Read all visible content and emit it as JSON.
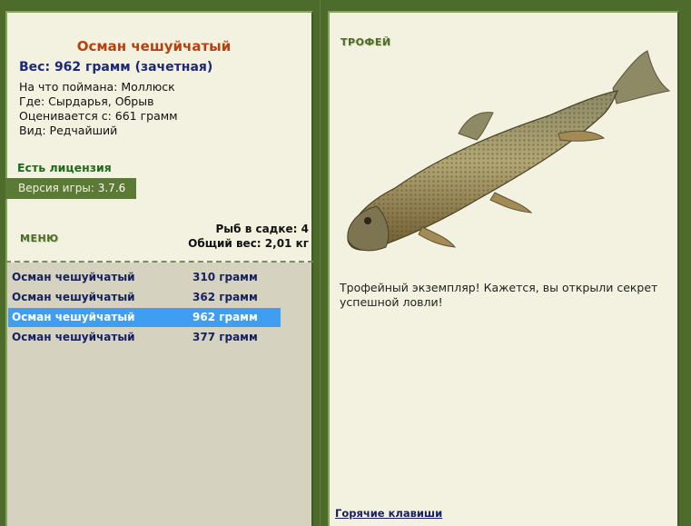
{
  "left": {
    "fish_name": "Осман чешуйчатый",
    "weight_line": "Вес: 962 грамм (зачетная)",
    "info": [
      "На что поймана: Моллюск",
      "Где: Сырдарья, Обрыв",
      "Оценивается с: 661 грамм",
      "Вид: Редчайший"
    ],
    "license": "Есть лицензия",
    "version_label": "Версия игры:",
    "version_value": "3.7.6",
    "menu_label": "МЕНЮ",
    "fish_count": "Рыб в садке: 4",
    "total_weight": "Общий вес: 2,01 кг"
  },
  "catch_list": [
    {
      "name": "Осман чешуйчатый",
      "weight": "310 грамм",
      "selected": false
    },
    {
      "name": "Осман чешуйчатый",
      "weight": "362 грамм",
      "selected": false
    },
    {
      "name": "Осман чешуйчатый",
      "weight": "962 грамм",
      "selected": true
    },
    {
      "name": "Осман чешуйчатый",
      "weight": "377 грамм",
      "selected": false
    }
  ],
  "right": {
    "trophy_label": "ТРОФЕЙ",
    "description": "Трофейный экземпляр! Кажется, вы открыли секрет успешной ловли!",
    "hotkeys_link": "Горячие клавиши",
    "fish_image_icon": "fish-icon"
  },
  "colors": {
    "frame": "#4d6c2c",
    "panel": "#f3f1df",
    "title": "#b5420e",
    "link": "#16205f",
    "selection": "#3f9df2",
    "list_bg": "#d5d3bf"
  }
}
